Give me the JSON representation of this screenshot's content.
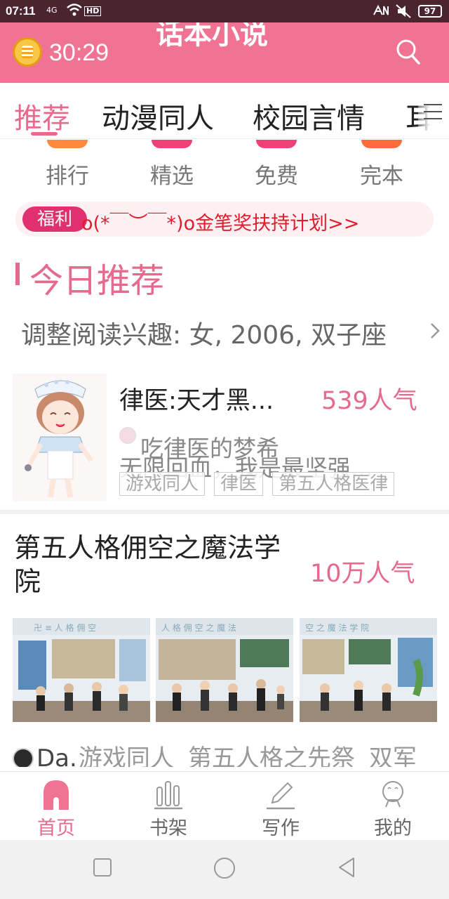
{
  "status_bar": {
    "time": "07:11",
    "network": "4G",
    "hd_label": "HD",
    "battery": "97"
  },
  "header": {
    "timer": "30:29",
    "title": "话本小说",
    "icons": [
      "alarm-coin-icon",
      "search-icon"
    ]
  },
  "tabs": [
    {
      "label": "推荐",
      "active": true
    },
    {
      "label": "动漫同人"
    },
    {
      "label": "校园言情"
    },
    {
      "label": "耳"
    }
  ],
  "categories": [
    {
      "label": "排行",
      "color": "#ff8a3d"
    },
    {
      "label": "精选",
      "color": "#f0407a"
    },
    {
      "label": "免费",
      "color": "#f0407a"
    },
    {
      "label": "完本",
      "color": "#ff6a3d"
    }
  ],
  "banner": {
    "badge": "福利",
    "text": "o(*￣︶￣*)o金笔奖扶持计划>>"
  },
  "section": {
    "title": "今日推荐"
  },
  "interest": {
    "text": "调整阅读兴趣: 女, 2006, 双子座"
  },
  "book1": {
    "title": "律医:天才黑...",
    "popularity": "539人气",
    "author": "吃律医的梦希",
    "description": "无限回血，我是最坚强...",
    "tags": [
      "游戏同人",
      "律医",
      "第五人格医律"
    ]
  },
  "book2": {
    "title": "第五人格佣空之魔法学院",
    "popularity": "10万人气",
    "author": "Da.",
    "tags": [
      "游戏同人",
      "第五人格之先祭",
      "双军"
    ]
  },
  "bottom_nav": [
    {
      "label": "首页",
      "icon": "home-icon",
      "active": true
    },
    {
      "label": "书架",
      "icon": "bookshelf-icon"
    },
    {
      "label": "写作",
      "icon": "pen-icon"
    },
    {
      "label": "我的",
      "icon": "profile-icon"
    }
  ],
  "colors": {
    "brand_pink": "#f07394",
    "accent": "#e66a8e",
    "status_bar": "#4a2530",
    "banner_red": "#e01d2c"
  }
}
